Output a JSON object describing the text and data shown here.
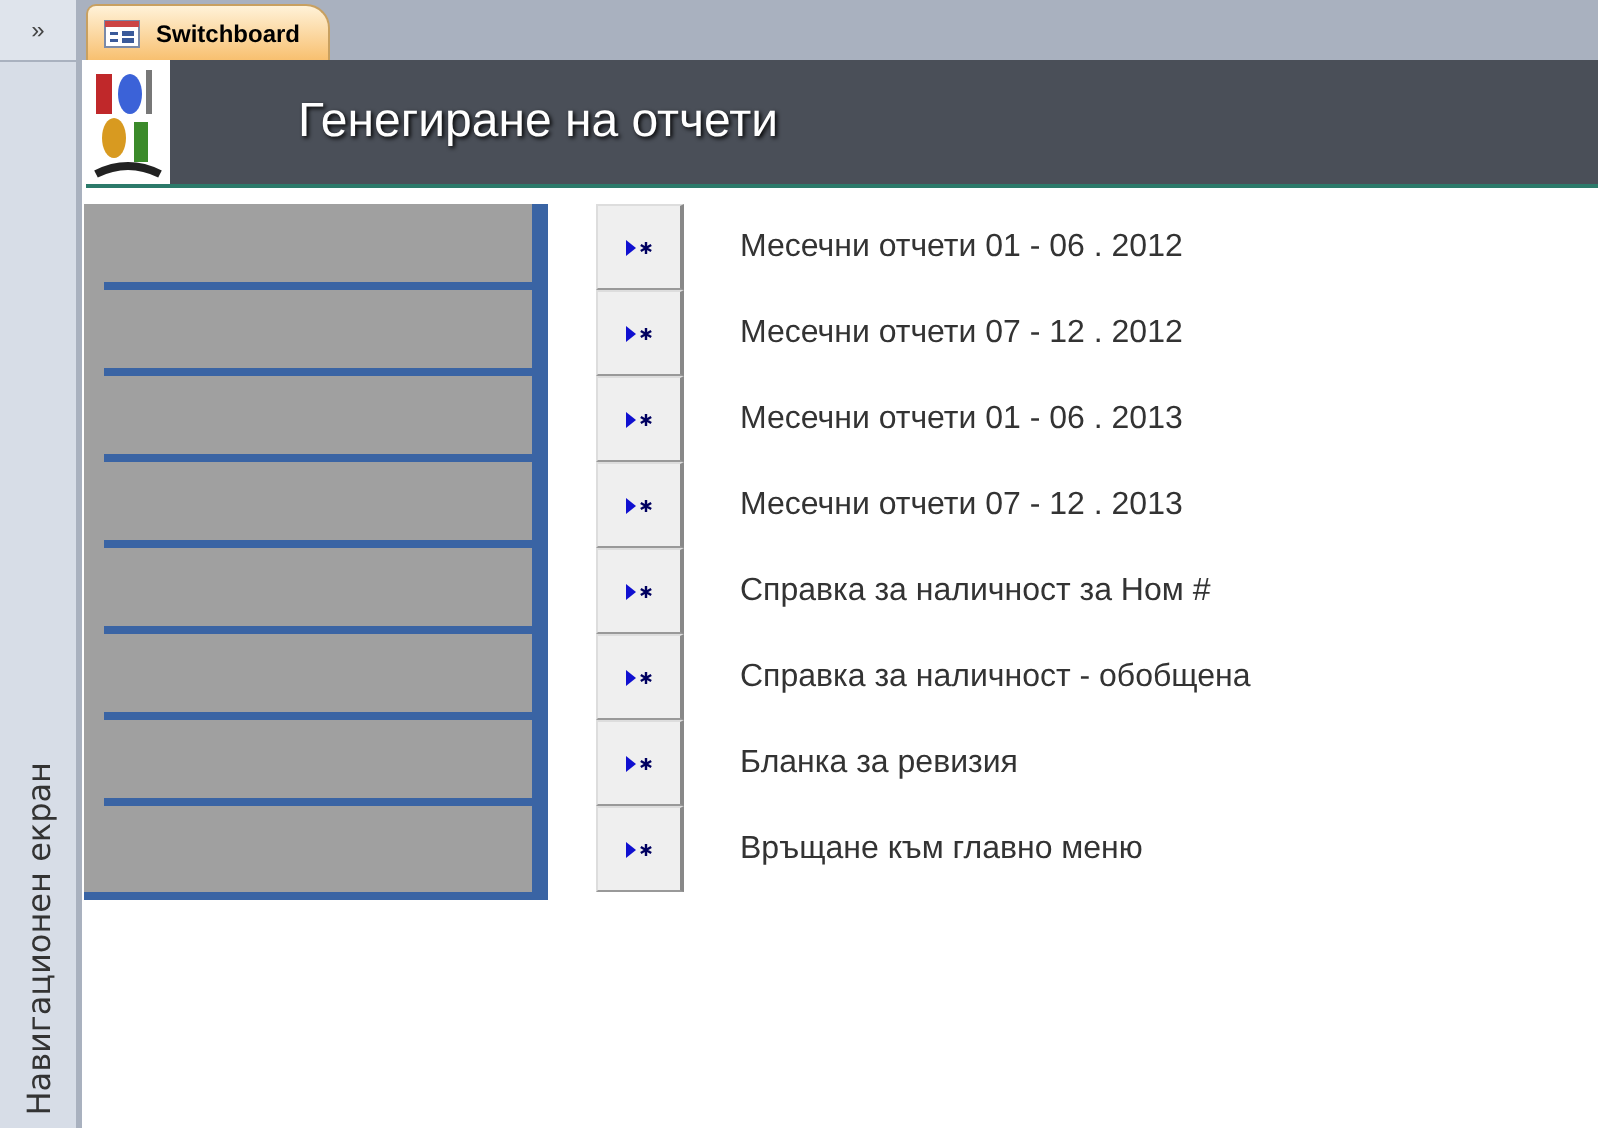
{
  "nav_pane": {
    "toggle": "»",
    "title": "Навигационен екран"
  },
  "tabs": [
    {
      "label": "Switchboard",
      "selected": true
    }
  ],
  "header": {
    "title": "Генегиране на отчети"
  },
  "items": [
    {
      "label": "Месечни отчети 01 - 06 . 2012"
    },
    {
      "label": "Месечни отчети 07 - 12 . 2012"
    },
    {
      "label": "Месечни отчети 01 - 06 . 2013"
    },
    {
      "label": "Месечни отчети 07 - 12 . 2013"
    },
    {
      "label": "Справка за наличност за Ном #"
    },
    {
      "label": "Справка за наличност - обобщена"
    },
    {
      "label": "Бланка за ревизия"
    },
    {
      "label": "Връщане към главно меню"
    }
  ]
}
